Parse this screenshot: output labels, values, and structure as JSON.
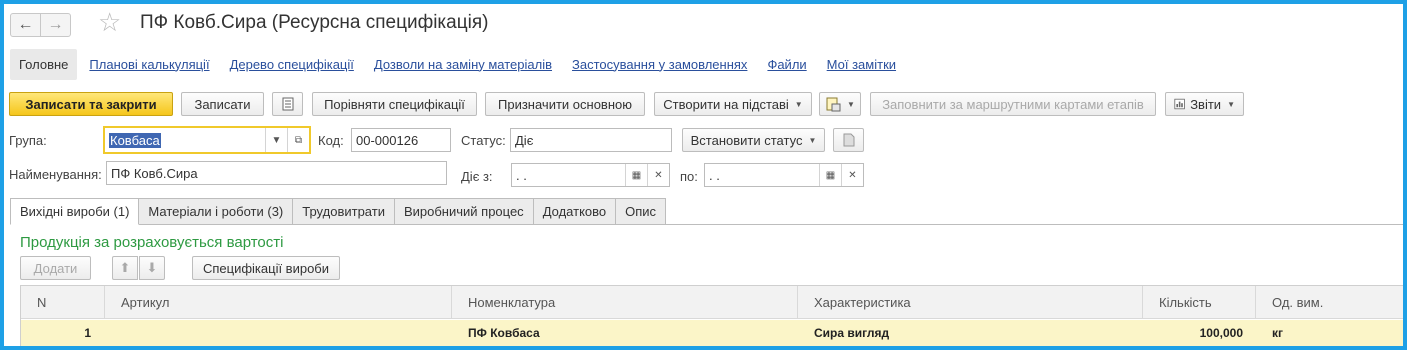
{
  "header": {
    "title": "ПФ Ковб.Сира (Ресурсна специфікація)",
    "back_icon": "arrow-left-icon",
    "forward_icon": "arrow-right-icon",
    "favorite_icon": "star-icon"
  },
  "nav_tabs": [
    {
      "label": "Головне",
      "active": true
    },
    {
      "label": "Планові калькуляції"
    },
    {
      "label": "Дерево специфікації"
    },
    {
      "label": "Дозволи на заміну матеріалів"
    },
    {
      "label": "Застосування у замовленнях"
    },
    {
      "label": "Файли"
    },
    {
      "label": "Мої замітки"
    }
  ],
  "toolbar": {
    "save_close": "Записати та закрити",
    "save": "Записати",
    "compare": "Порівняти специфікації",
    "set_main": "Призначити основною",
    "create_based": "Створити на підставі",
    "fill_routes": "Заповнити за маршрутними картами етапів",
    "reports": "Звіти"
  },
  "form": {
    "group_label": "Група:",
    "group_value": "Ковбаса",
    "code_label": "Код:",
    "code_value": "00-000126",
    "status_label": "Статус:",
    "status_value": "Діє",
    "set_status": "Встановити статус",
    "name_label": "Найменування:",
    "name_value": "ПФ Ковб.Сира",
    "valid_from_label": "Діє з:",
    "valid_from_value": " .  .",
    "valid_to_label": "по:",
    "valid_to_value": " .  ."
  },
  "content_tabs": [
    "Вихідні вироби (1)",
    "Матеріали і роботи (3)",
    "Трудовитрати",
    "Виробничий процес",
    "Додатково",
    "Опис"
  ],
  "section": {
    "title": "Продукція за розраховується вартості",
    "add": "Додати",
    "spec_products": "Специфікації вироби"
  },
  "table": {
    "headers": [
      "N",
      "Артикул",
      "Номенклатура",
      "Характеристика",
      "Кількість",
      "Од. вим."
    ],
    "rows": [
      {
        "n": "1",
        "article": "",
        "nomenclature": "ПФ Ковбаса",
        "characteristic": "Сира вигляд",
        "quantity": "100,000",
        "unit": "кг"
      }
    ]
  },
  "colors": {
    "accent_border": "#1ea0e6",
    "primary_button": "#f5c61b",
    "section_title": "#2e9a42",
    "selected_row": "#fbf5c8",
    "link": "#2a4f9c"
  }
}
